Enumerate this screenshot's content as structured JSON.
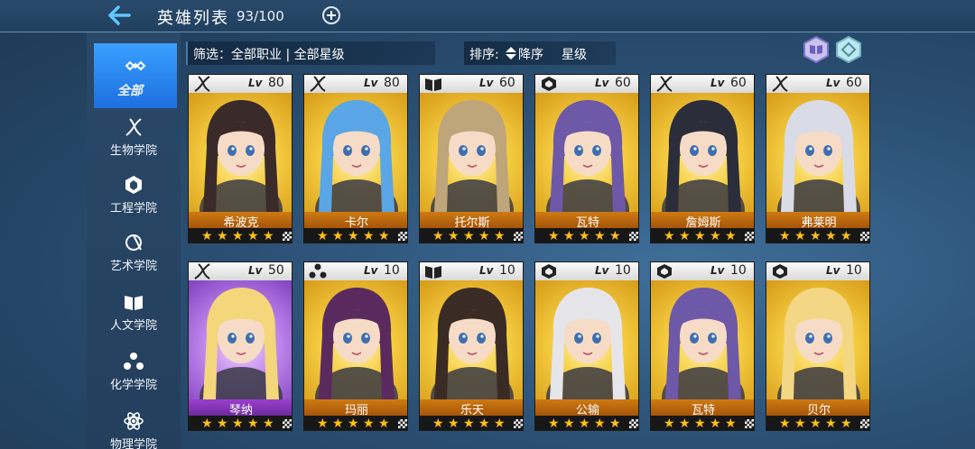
{
  "header": {
    "title": "英雄列表",
    "count": "93/100"
  },
  "sidebar": {
    "items": [
      {
        "label": "全部",
        "icon": "infinity-icon",
        "active": true
      },
      {
        "label": "生物学院",
        "icon": "dna-icon"
      },
      {
        "label": "工程学院",
        "icon": "gear-cluster-icon"
      },
      {
        "label": "艺术学院",
        "icon": "palette-icon"
      },
      {
        "label": "人文学院",
        "icon": "book-icon"
      },
      {
        "label": "化学学院",
        "icon": "molecule-icon"
      },
      {
        "label": "物理学院",
        "icon": "atom-icon"
      }
    ]
  },
  "filter": {
    "text": "筛选：全部职业 | 全部星级"
  },
  "sort": {
    "label": "排序:",
    "order": "降序",
    "by": "星级"
  },
  "lv_label": "Lv",
  "heroes": [
    {
      "name": "希波克",
      "level": "80",
      "stars": 5,
      "class_icon": "dna-icon",
      "rarity": "gold",
      "hair": "#3b2a2a"
    },
    {
      "name": "卡尔",
      "level": "80",
      "stars": 5,
      "class_icon": "dna-icon",
      "rarity": "gold",
      "hair": "#5aa6e6"
    },
    {
      "name": "托尔斯",
      "level": "60",
      "stars": 5,
      "class_icon": "book-icon",
      "rarity": "gold",
      "hair": "#bfa57a"
    },
    {
      "name": "瓦特",
      "level": "60",
      "stars": 5,
      "class_icon": "gear-cluster-icon",
      "rarity": "gold",
      "hair": "#6e58a8"
    },
    {
      "name": "詹姆斯",
      "level": "60",
      "stars": 5,
      "class_icon": "dna-icon",
      "rarity": "gold",
      "hair": "#2b2e3a"
    },
    {
      "name": "弗莱明",
      "level": "60",
      "stars": 5,
      "class_icon": "dna-icon",
      "rarity": "gold",
      "hair": "#d9dbe6"
    },
    {
      "name": "琴纳",
      "level": "50",
      "stars": 5,
      "class_icon": "dna-icon",
      "rarity": "purple",
      "hair": "#f3d77a"
    },
    {
      "name": "玛丽",
      "level": "10",
      "stars": 5,
      "class_icon": "molecule-icon",
      "rarity": "gold",
      "hair": "#5a2a5e"
    },
    {
      "name": "乐天",
      "level": "10",
      "stars": 5,
      "class_icon": "book-icon",
      "rarity": "gold",
      "hair": "#3a2b25"
    },
    {
      "name": "公输",
      "level": "10",
      "stars": 5,
      "class_icon": "gear-cluster-icon",
      "rarity": "gold",
      "hair": "#e6e6ea"
    },
    {
      "name": "瓦特",
      "level": "10",
      "stars": 5,
      "class_icon": "gear-cluster-icon",
      "rarity": "gold",
      "hair": "#6e58a8"
    },
    {
      "name": "贝尔",
      "level": "10",
      "stars": 5,
      "class_icon": "gear-cluster-icon",
      "rarity": "gold",
      "hair": "#f4d784"
    }
  ]
}
